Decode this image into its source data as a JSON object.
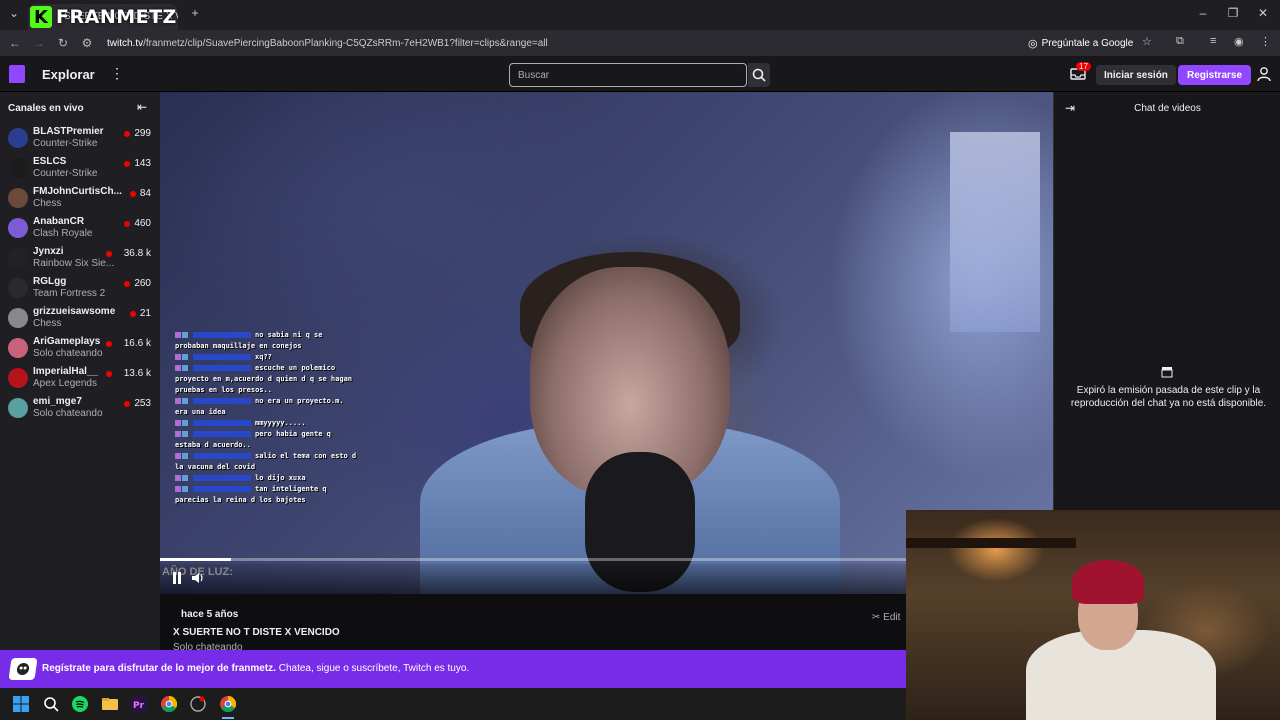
{
  "browser": {
    "tab_title": "SUERTE NO T DISTE X VE",
    "overlay_brand": "FRANMETZ",
    "overlay_logo": "K",
    "url_host": "twitch.tv",
    "url_path": "/franmetz/clip/SuavePiercingBaboonPlanking-C5QZsRRm-7eH2WB1?filter=clips&range=all",
    "ask_google": "Pregúntale a Google"
  },
  "topnav": {
    "explore": "Explorar",
    "search_placeholder": "Buscar",
    "notifications_count": "17",
    "login": "Iniciar sesión",
    "register": "Registrarse"
  },
  "sidebar": {
    "heading": "Canales en vivo",
    "channels": [
      {
        "name": "BLASTPremier",
        "game": "Counter-Strike",
        "viewers": "299",
        "color": "#2a3d8f"
      },
      {
        "name": "ESLCS",
        "game": "Counter-Strike",
        "viewers": "143",
        "color": "#1b1b1b"
      },
      {
        "name": "FMJohnCurtisCh...",
        "game": "Chess",
        "viewers": "84",
        "color": "#6b4a3a"
      },
      {
        "name": "AnabanCR",
        "game": "Clash Royale",
        "viewers": "460",
        "color": "#7e5bd6"
      },
      {
        "name": "Jynxzi",
        "game": "Rainbow Six Sie...",
        "viewers": "36.8 k",
        "color": "#222222"
      },
      {
        "name": "RGLgg",
        "game": "Team Fortress 2",
        "viewers": "260",
        "color": "#2a2a2a"
      },
      {
        "name": "grizzueisawsome",
        "game": "Chess",
        "viewers": "21",
        "color": "#888888"
      },
      {
        "name": "AriGameplays",
        "game": "Solo chateando",
        "viewers": "16.6 k",
        "color": "#c8627a"
      },
      {
        "name": "ImperialHal__",
        "game": "Apex Legends",
        "viewers": "13.6 k",
        "color": "#b5121b"
      },
      {
        "name": "emi_mge7",
        "game": "Solo chateando",
        "viewers": "253",
        "color": "#5aa0a0"
      }
    ]
  },
  "video": {
    "overlay_chat": [
      "no sabia ni q se",
      "probaban maquillaje en conejos",
      "xq??",
      "escuche un polemico",
      "proyecto en m,acuerdo d quien d q se hagan",
      "pruebas en los presos..",
      "no era un proyecto.m.",
      "era una idea",
      "mmyyyyy.....",
      "pero habia gente q",
      "estaba d acuerdo..",
      "salio el tema con esto d",
      "la vacuna del covid",
      "lo dijo xuxa",
      "tan inteligente q",
      "parecias la reina d los bajotes"
    ],
    "bottom_label": "AÑO DE LUZ:",
    "progress": 0.08
  },
  "clip": {
    "time_ago": "hace 5 años",
    "title": "X SUERTE NO T DISTE X VENCIDO",
    "category": "Solo chateando",
    "edit": "Edit"
  },
  "chat": {
    "title": "Chat de videos",
    "message": "Expiró la emisión pasada de este clip y la reproducción del chat ya no está disponible."
  },
  "banner": {
    "bold": "Regístrate para disfrutar de lo mejor de franmetz.",
    "rest": "Chatea, sigue o suscríbete, Twitch es tuyo."
  },
  "colors": {
    "twitch_purple": "#9147ff",
    "banner_purple": "#772ce8",
    "live_red": "#eb0400"
  }
}
